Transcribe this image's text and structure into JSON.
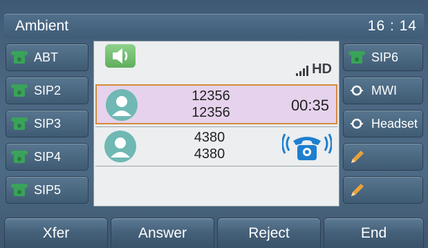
{
  "header": {
    "title": "Ambient",
    "time": "16 : 14"
  },
  "line_keys_left": [
    {
      "label": "ABT",
      "icon": "phone-icon"
    },
    {
      "label": "SIP2",
      "icon": "phone-icon"
    },
    {
      "label": "SIP3",
      "icon": "phone-icon"
    },
    {
      "label": "SIP4",
      "icon": "phone-icon"
    },
    {
      "label": "SIP5",
      "icon": "phone-icon"
    }
  ],
  "line_keys_right": [
    {
      "label": "SIP6",
      "icon": "phone-icon"
    },
    {
      "label": "MWI",
      "icon": "blf-icon"
    },
    {
      "label": "Headset",
      "icon": "blf-icon"
    },
    {
      "label": "",
      "icon": "pencil-icon"
    },
    {
      "label": "",
      "icon": "pencil-icon"
    }
  ],
  "status": {
    "audio_mode_icon": "speaker-icon",
    "hd_label": "HD"
  },
  "calls": [
    {
      "name": "12356",
      "number": "12356",
      "duration": "00:35",
      "state": "active"
    },
    {
      "name": "4380",
      "number": "4380",
      "state": "incoming",
      "icon": "ringing-phone-icon"
    }
  ],
  "softkeys": [
    "Xfer",
    "Answer",
    "Reject",
    "End"
  ],
  "colors": {
    "accent_orange": "#d48a3c",
    "active_row": "#e6d2ec",
    "ringing_blue": "#1e7fd0",
    "phone_green": "#3aa35a"
  }
}
